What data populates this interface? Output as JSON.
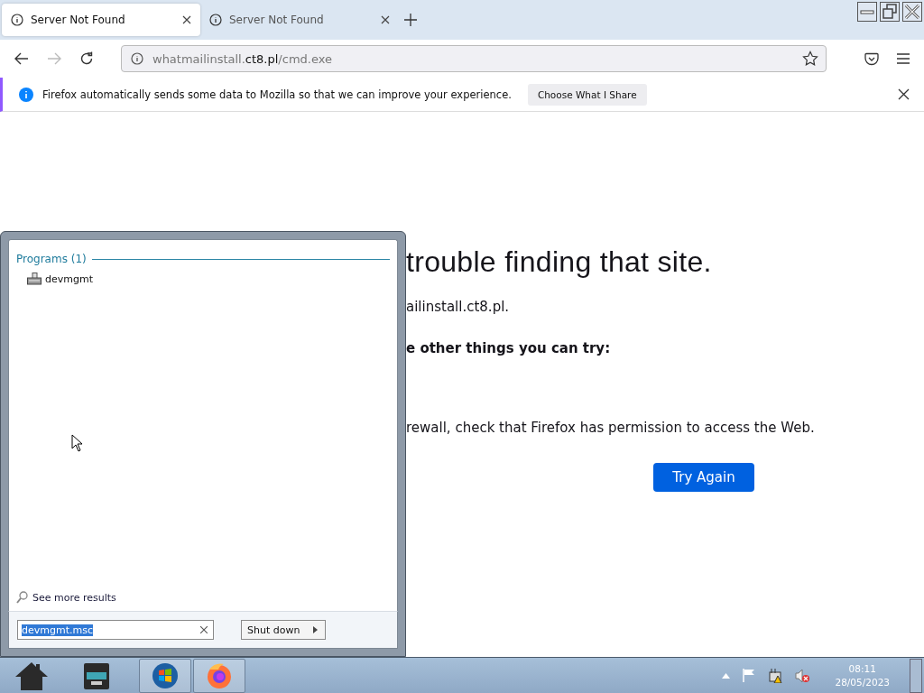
{
  "tabs": [
    {
      "title": "Server Not Found",
      "selected": true
    },
    {
      "title": "Server Not Found",
      "selected": false
    }
  ],
  "url": {
    "host": "whatmailinstall.",
    "domain": "ct8.pl",
    "path": "/cmd.exe"
  },
  "notification": {
    "message": "Firefox automatically sends some data to Mozilla so that we can improve your experience.",
    "button": "Choose What I Share"
  },
  "error_page": {
    "title": "trouble finding that site.",
    "host_line": "ailinstall.ct8.pl.",
    "suggestions_heading": "e other things you can try:",
    "firewall_line": "rewall, check that Firefox has permission to access the Web.",
    "button": "Try Again"
  },
  "start_menu": {
    "section": "Programs (1)",
    "programs": [
      {
        "name": "devmgmt"
      }
    ],
    "see_more": "See more results",
    "search": {
      "value": "devmgmt.msc",
      "selected": true
    },
    "shutdown": "Shut down"
  },
  "taskbar": {
    "items": [
      {
        "kind": "home",
        "open": false
      },
      {
        "kind": "files",
        "open": false
      },
      {
        "kind": "start",
        "open": true
      },
      {
        "kind": "firefox",
        "open": true
      }
    ],
    "time": "08:11",
    "date": "28/05/2023"
  }
}
